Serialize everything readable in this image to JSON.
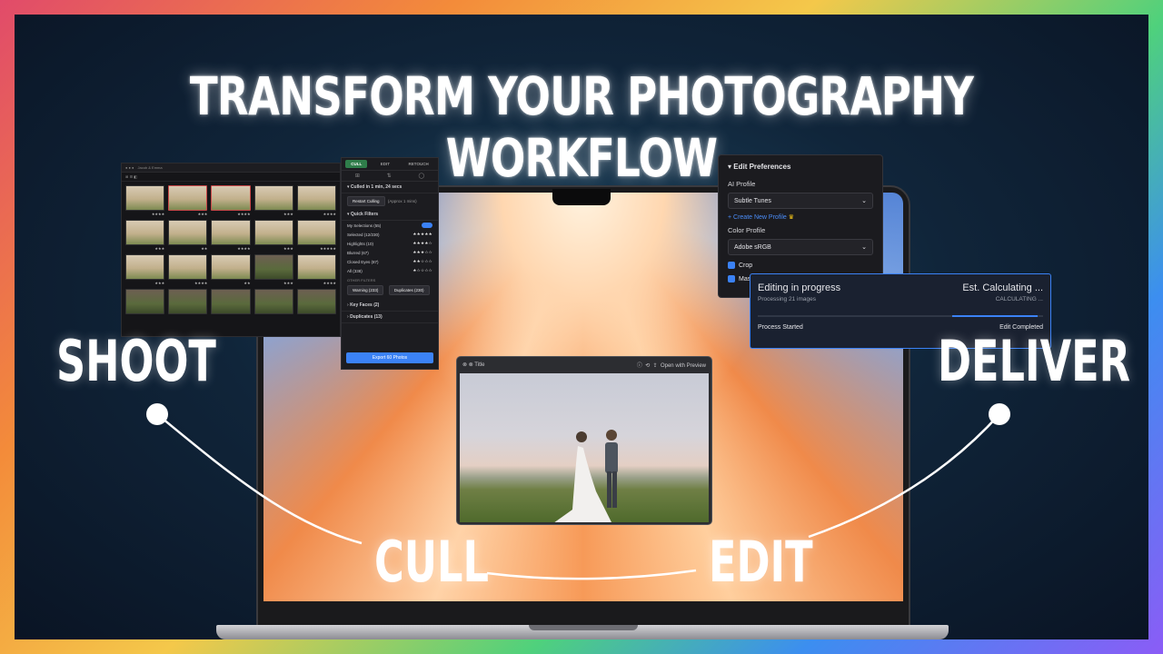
{
  "headline": "TRANSFORM YOUR PHOTOGRAPHY WORKFLOW",
  "workflow": {
    "shoot": "SHOOT",
    "cull": "CULL",
    "edit": "EDIT",
    "deliver": "DELIVER"
  },
  "cull_panel": {
    "tabs": [
      "CULL",
      "EDIT",
      "RETOUCH"
    ],
    "summary": "Culled in 1 min, 24 secs",
    "restart_label": "Restart Culling",
    "approx": "(Approx 1 mins)",
    "quick_filters_label": "Quick Filters",
    "filters": [
      {
        "label": "My Selections (55)",
        "stars": ""
      },
      {
        "label": "Selected (12/230)",
        "stars": "★★★★★"
      },
      {
        "label": "Highlights (10)",
        "stars": "★★★★☆"
      },
      {
        "label": "Blurred (67)",
        "stars": "★★★☆☆"
      },
      {
        "label": "Closed Eyes (87)",
        "stars": "★★☆☆☆"
      },
      {
        "label": "All (338)",
        "stars": "★☆☆☆☆"
      }
    ],
    "other_filters_label": "OTHER FILTERS",
    "warnings_label": "Warning (233)",
    "duplicates_chip": "Duplicates (230)",
    "key_faces": "Key Faces (2)",
    "duplicates": "Duplicates (13)",
    "export_label": "Export 60 Photos"
  },
  "edit_prefs": {
    "title": "Edit Preferences",
    "ai_profile_label": "AI Profile",
    "ai_profile_value": "Subtle Tunes",
    "create_profile": "+ Create New Profile",
    "color_profile_label": "Color Profile",
    "color_profile_value": "Adobe sRGB",
    "check1": "Crop",
    "check2": "Mask"
  },
  "progress": {
    "title": "Editing in progress",
    "subtitle": "Processing 21 images",
    "estimate": "Est. Calculating ...",
    "status": "CALCULATING ...",
    "started": "Process Started",
    "completed": "Edit Completed",
    "fill_fraction": 0.3
  },
  "preview": {
    "title": "Title",
    "open_label": "Open with Preview"
  },
  "colors": {
    "accent": "#3b82f6",
    "cull_tab": "#2f7d4a"
  }
}
